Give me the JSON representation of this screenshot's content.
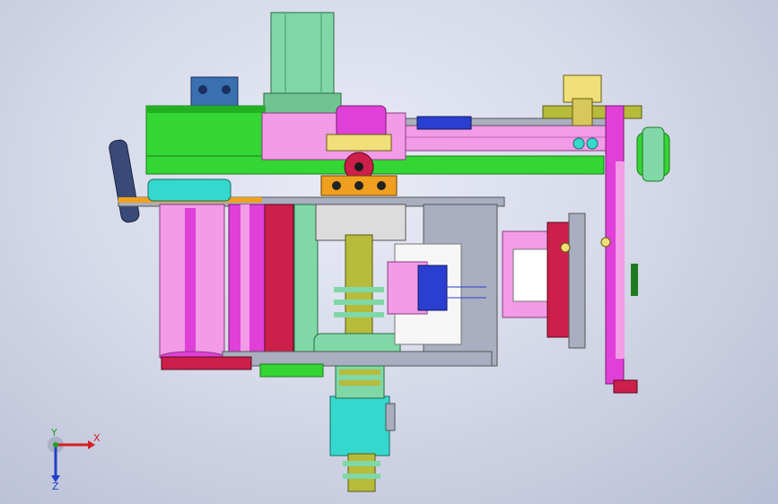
{
  "viewport": {
    "background_top": "#e9ecf6",
    "background_bottom": "#b7bdd4"
  },
  "triad": {
    "x_label": "X",
    "y_label": "Y",
    "z_label": "Z",
    "x_color": "#d42020",
    "y_color": "#20a020",
    "z_color": "#2040c8"
  },
  "palette": {
    "green": "#33d633",
    "magenta": "#e040d8",
    "pink": "#f29be6",
    "cyan": "#35d8cc",
    "olive": "#b7bb3a",
    "red": "#cc1f4a",
    "blue": "#2a3fd0",
    "orange": "#f0a020",
    "mint": "#7fd8a6",
    "grey": "#a9aec0",
    "yellow": "#f0e07a"
  }
}
